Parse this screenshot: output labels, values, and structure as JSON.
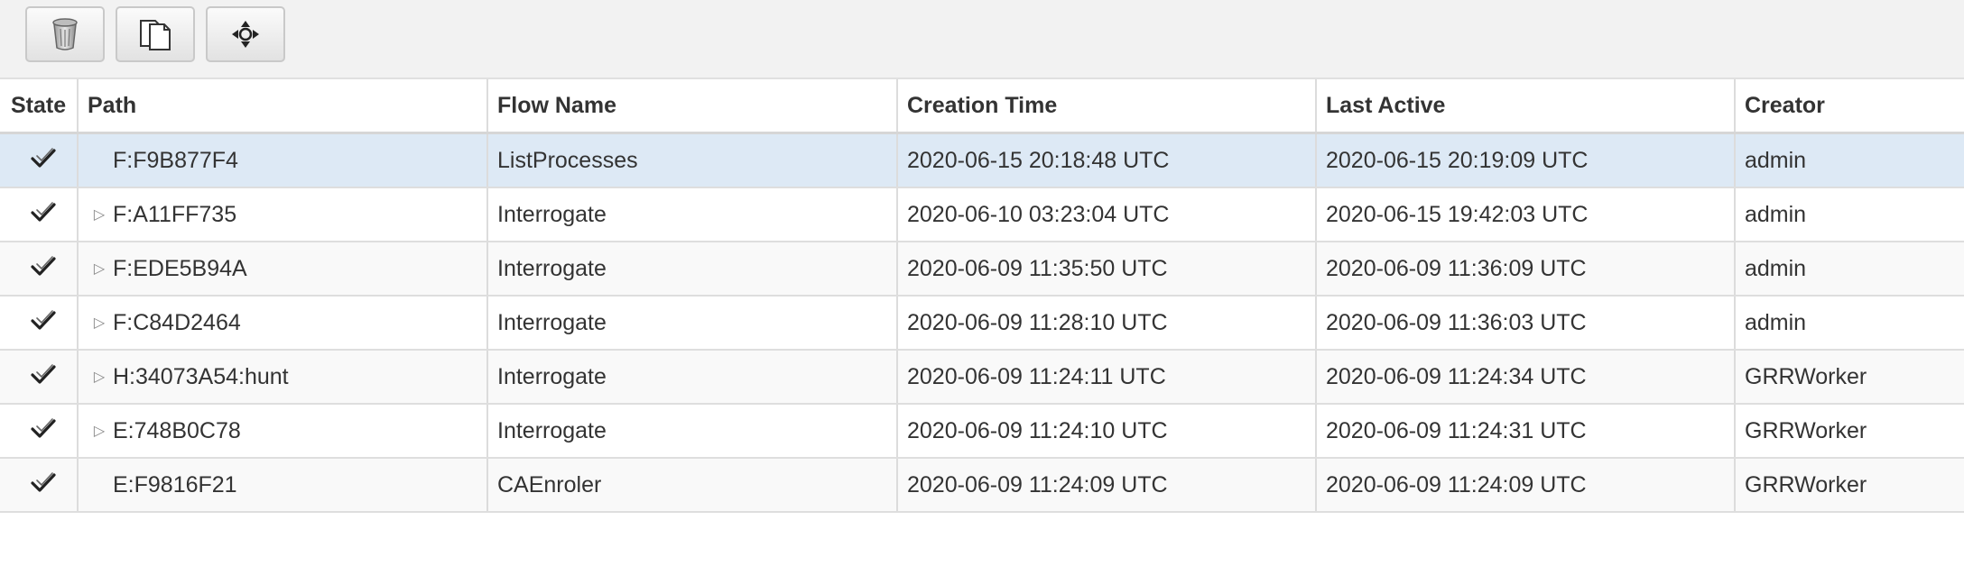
{
  "toolbar": {
    "buttons": [
      {
        "icon": "trash-icon",
        "name": "delete-button"
      },
      {
        "icon": "copy-icon",
        "name": "copy-button"
      },
      {
        "icon": "move-icon",
        "name": "move-button"
      }
    ]
  },
  "table": {
    "headers": {
      "state": "State",
      "path": "Path",
      "flow_name": "Flow Name",
      "creation_time": "Creation Time",
      "last_active": "Last Active",
      "creator": "Creator"
    },
    "rows": [
      {
        "state": "check-icon",
        "expandable": false,
        "path": "F:F9B877F4",
        "flow_name": "ListProcesses",
        "creation_time": "2020-06-15 20:18:48 UTC",
        "last_active": "2020-06-15 20:19:09 UTC",
        "creator": "admin"
      },
      {
        "state": "check-icon",
        "expandable": true,
        "path": "F:A11FF735",
        "flow_name": "Interrogate",
        "creation_time": "2020-06-10 03:23:04 UTC",
        "last_active": "2020-06-15 19:42:03 UTC",
        "creator": "admin"
      },
      {
        "state": "check-icon",
        "expandable": true,
        "path": "F:EDE5B94A",
        "flow_name": "Interrogate",
        "creation_time": "2020-06-09 11:35:50 UTC",
        "last_active": "2020-06-09 11:36:09 UTC",
        "creator": "admin"
      },
      {
        "state": "check-icon",
        "expandable": true,
        "path": "F:C84D2464",
        "flow_name": "Interrogate",
        "creation_time": "2020-06-09 11:28:10 UTC",
        "last_active": "2020-06-09 11:36:03 UTC",
        "creator": "admin"
      },
      {
        "state": "check-icon",
        "expandable": true,
        "path": "H:34073A54:hunt",
        "flow_name": "Interrogate",
        "creation_time": "2020-06-09 11:24:11 UTC",
        "last_active": "2020-06-09 11:24:34 UTC",
        "creator": "GRRWorker"
      },
      {
        "state": "check-icon",
        "expandable": true,
        "path": "E:748B0C78",
        "flow_name": "Interrogate",
        "creation_time": "2020-06-09 11:24:10 UTC",
        "last_active": "2020-06-09 11:24:31 UTC",
        "creator": "GRRWorker"
      },
      {
        "state": "check-icon",
        "expandable": false,
        "path": "E:F9816F21",
        "flow_name": "CAEnroler",
        "creation_time": "2020-06-09 11:24:09 UTC",
        "last_active": "2020-06-09 11:24:09 UTC",
        "creator": "GRRWorker"
      }
    ],
    "selected_row": 0
  },
  "colors": {
    "selected_row": "#dde9f5",
    "toolbar_bg": "#f2f2f2"
  }
}
